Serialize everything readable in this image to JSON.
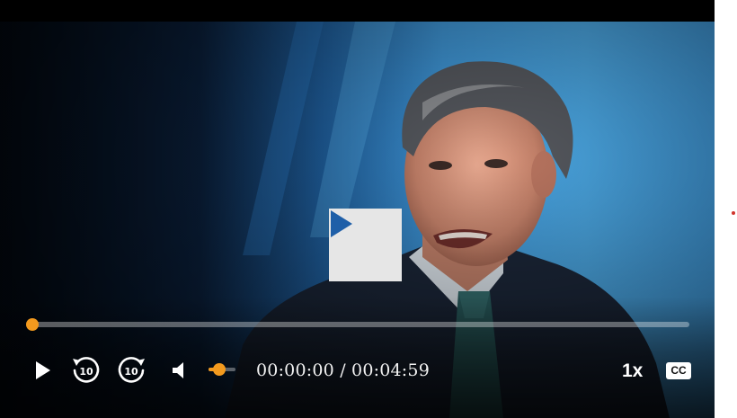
{
  "player": {
    "current_time": "00:00:00",
    "separator": "/",
    "duration": "00:04:59",
    "progress_fraction": 0,
    "volume_fraction": 0.4,
    "speed_label": "1x",
    "cc_label": "CC",
    "skip_back_seconds": "10",
    "skip_forward_seconds": "10",
    "accent_color": "#f39a1e",
    "icons": {
      "big_play": "play-icon",
      "play": "play-icon",
      "skip_back": "rewind-10-icon",
      "skip_forward": "forward-10-icon",
      "volume": "speaker-icon"
    }
  }
}
